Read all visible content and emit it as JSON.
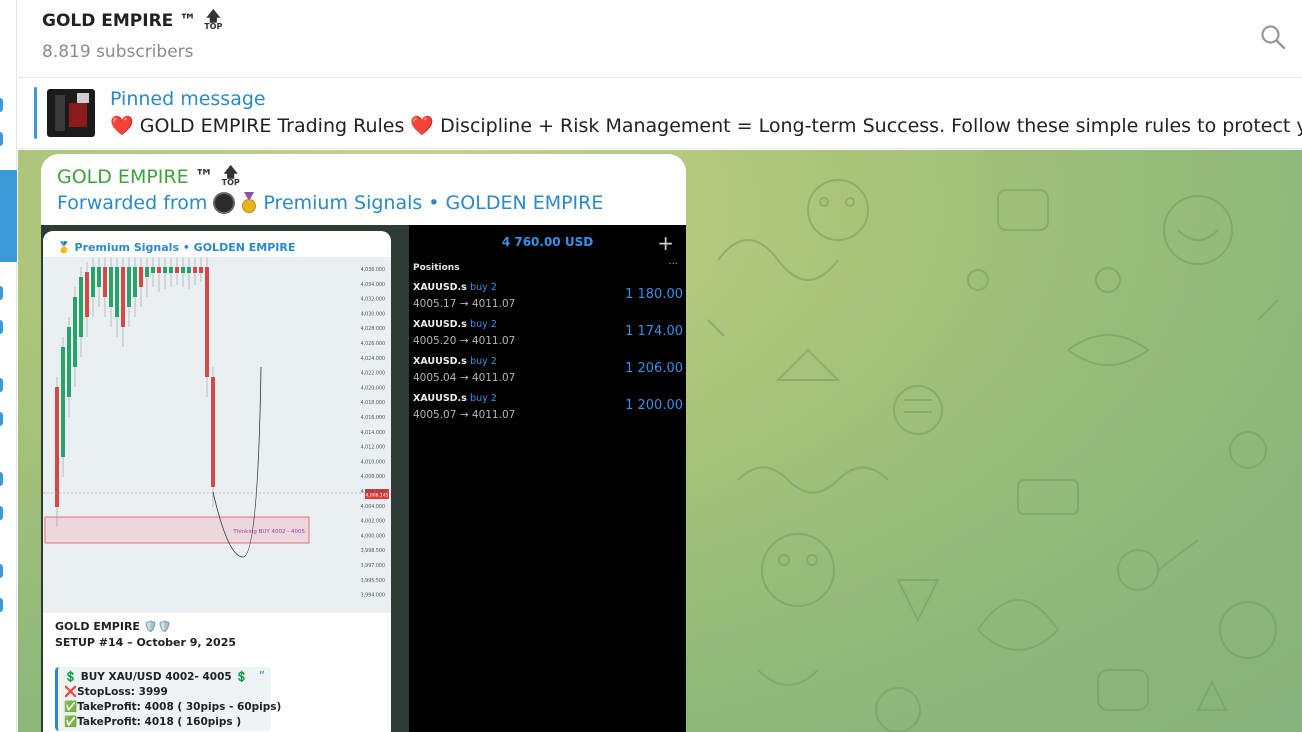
{
  "header": {
    "title": "GOLD EMPIRE ™",
    "top_badge": "TOP",
    "subscribers": "8.819 subscribers"
  },
  "pinned": {
    "label": "Pinned message",
    "heart": "❤️",
    "text_part1": "GOLD EMPIRE Trading Rules",
    "text_part2": "Discipline + Risk Management = Long-term Success. Follow these simple rules to protect your cap"
  },
  "message": {
    "sender": "GOLD EMPIRE",
    "sender_tm": "™",
    "top_badge": "TOP",
    "forwarded_prefix": "Forwarded from",
    "forwarded_source": "Premium Signals • GOLDEN EMPIRE"
  },
  "left_image": {
    "header": "Premium Signals • GOLDEN EMPIRE",
    "zone_label": "Thinking BUY 4002 - 4005",
    "price_tag": "4,006.145",
    "y_ticks": [
      "4,036.000",
      "4,034.000",
      "4,032.000",
      "4,030.000",
      "4,028.000",
      "4,026.000",
      "4,024.000",
      "4,022.000",
      "4,020.000",
      "4,018.000",
      "4,016.000",
      "4,014.000",
      "4,012.000",
      "4,010.000",
      "4,008.000",
      "4,006.000",
      "4,004.000",
      "4,002.000",
      "4,000.000",
      "3,998.500",
      "3,997.000",
      "3,995.500",
      "3,994.000"
    ],
    "card_title": "GOLD EMPIRE 🛡️🛡️",
    "card_setup": "SETUP #14 – October 9, 2025",
    "signal": {
      "buy": "💲 BUY XAU/USD 4002- 4005 💲",
      "stoploss": "❌StopLoss: 3999",
      "tp1": "✅TakeProfit: 4008 ( 30pips - 60pips)",
      "tp2": "✅TakeProfit: 4018 ( 160pips )",
      "quote": "”"
    }
  },
  "right_image": {
    "balance": "4 760.00 USD",
    "plus": "+",
    "positions_label": "Positions",
    "dots": "···",
    "rows": [
      {
        "symbol": "XAUUSD.s",
        "side": "buy 2",
        "prices": "4005.17 → 4011.07",
        "pnl": "1 180.00"
      },
      {
        "symbol": "XAUUSD.s",
        "side": "buy 2",
        "prices": "4005.20 → 4011.07",
        "pnl": "1 174.00"
      },
      {
        "symbol": "XAUUSD.s",
        "side": "buy 2",
        "prices": "4005.04 → 4011.07",
        "pnl": "1 206.00"
      },
      {
        "symbol": "XAUUSD.s",
        "side": "buy 2",
        "prices": "4005.07 → 4011.07",
        "pnl": "1 200.00"
      }
    ]
  },
  "icons": {
    "search": "search-icon",
    "top_arrow": "up-arrow-icon",
    "avatar": "channel-avatar"
  },
  "colors": {
    "accent": "#3a9bd8",
    "link": "#2a8ac9",
    "sender": "#3ca43a",
    "pnl": "#3a8fe8"
  }
}
